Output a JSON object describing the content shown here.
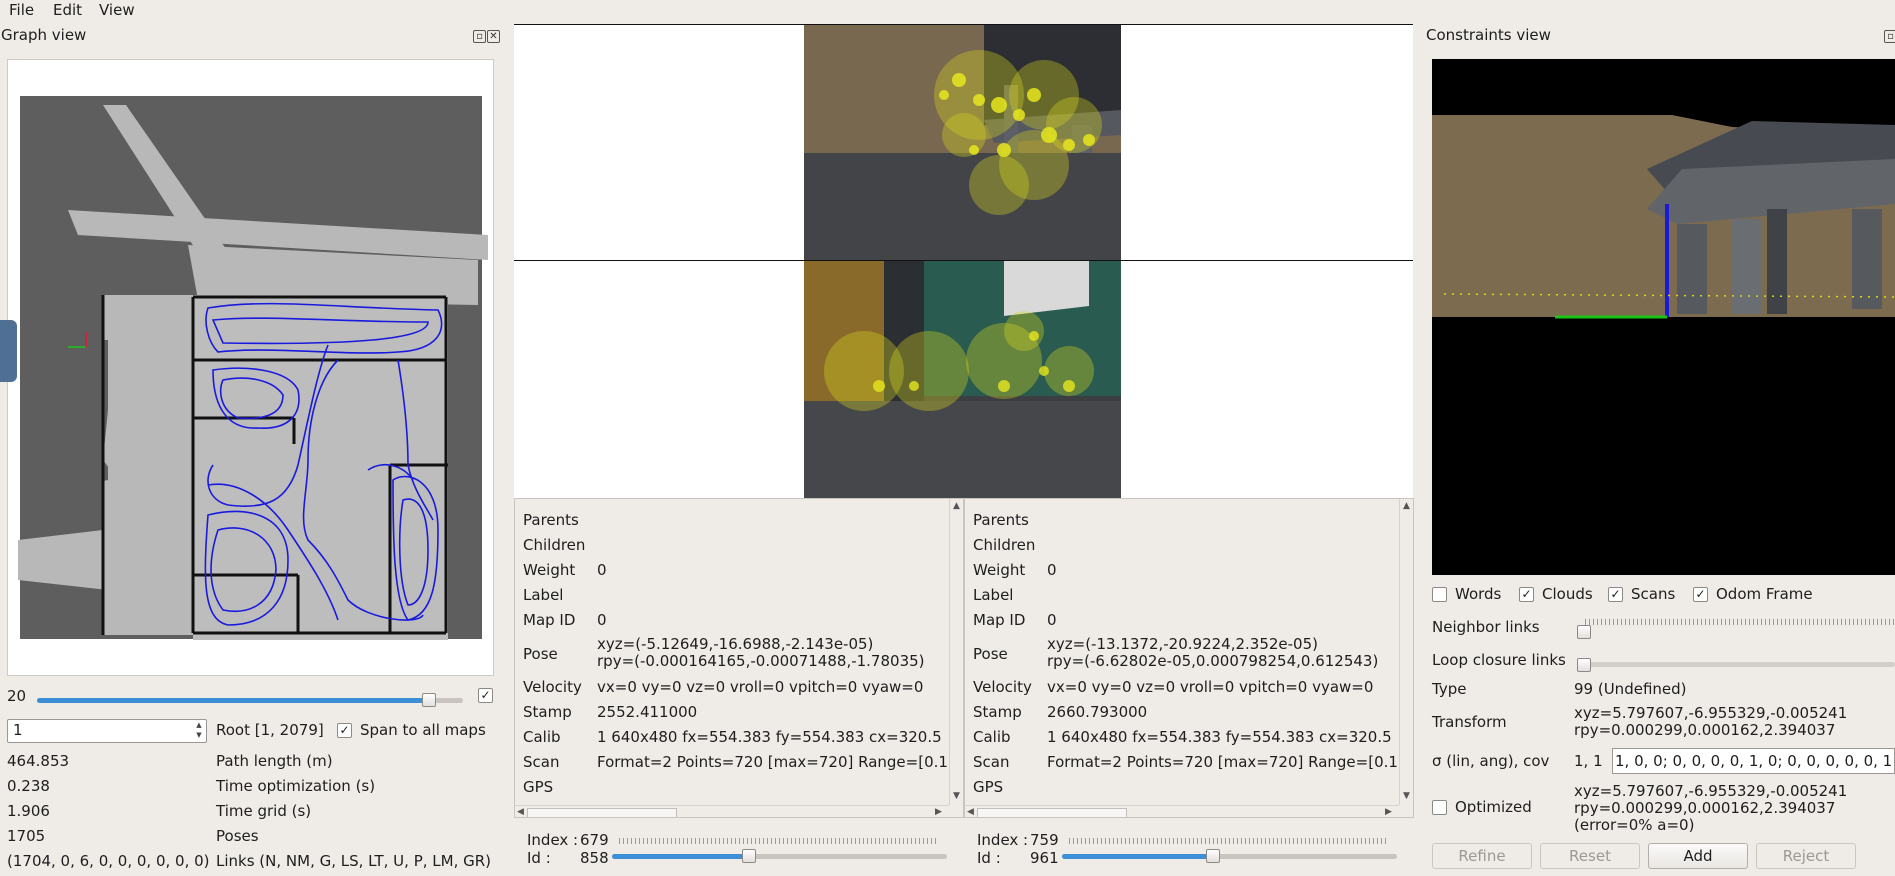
{
  "menu": {
    "file": "File",
    "edit": "Edit",
    "view": "View"
  },
  "graph_view": {
    "title": "Graph view",
    "slider_value": "20",
    "slider_fraction": 0.92,
    "slider_checked": true,
    "spin_value": "1",
    "root_label": "Root [1, 2079]",
    "span_label": "Span to all maps",
    "span_checked": true,
    "stats": [
      {
        "value": "464.853",
        "label": "Path length (m)"
      },
      {
        "value": "0.238",
        "label": "Time optimization (s)"
      },
      {
        "value": "1.906",
        "label": "Time grid (s)"
      },
      {
        "value": "1705",
        "label": "Poses"
      },
      {
        "value": "(1704, 0, 6, 0, 0, 0, 0, 0, 0)",
        "label": "Links (N, NM, G, LS, LT, U, P, LM, GR)"
      }
    ]
  },
  "info_left": {
    "parents": "Parents",
    "children": "Children",
    "weight_label": "Weight",
    "weight": "0",
    "label_label": "Label",
    "mapid_label": "Map ID",
    "mapid": "0",
    "pose_label": "Pose",
    "pose_xyz": "xyz=(-5.12649,-16.6988,-2.143e-05)",
    "pose_rpy": "rpy=(-0.000164165,-0.00071488,-1.78035)",
    "velocity_label": "Velocity",
    "velocity": "vx=0 vy=0 vz=0 vroll=0 vpitch=0 vyaw=0",
    "stamp_label": "Stamp",
    "stamp": "2552.411000",
    "calib_label": "Calib",
    "calib": "1 640x480 fx=554.383 fy=554.383 cx=320.5",
    "scan_label": "Scan",
    "scan": "Format=2 Points=720 [max=720] Range=[0.1",
    "gps_label": "GPS",
    "index_label": "Index :",
    "index": "679",
    "id_label": "Id :",
    "id": "858",
    "id_fraction": 0.41
  },
  "info_right": {
    "parents": "Parents",
    "children": "Children",
    "weight_label": "Weight",
    "weight": "0",
    "label_label": "Label",
    "mapid_label": "Map ID",
    "mapid": "0",
    "pose_label": "Pose",
    "pose_xyz": "xyz=(-13.1372,-20.9224,2.352e-05)",
    "pose_rpy": "rpy=(-6.62802e-05,0.000798254,0.612543)",
    "velocity_label": "Velocity",
    "velocity": "vx=0 vy=0 vz=0 vroll=0 vpitch=0 vyaw=0",
    "stamp_label": "Stamp",
    "stamp": "2660.793000",
    "calib_label": "Calib",
    "calib": "1 640x480 fx=554.383 fy=554.383 cx=320.5",
    "scan_label": "Scan",
    "scan": "Format=2 Points=720 [max=720] Range=[0.1",
    "gps_label": "GPS",
    "index_label": "Index :",
    "index": "759",
    "id_label": "Id :",
    "id": "961",
    "id_fraction": 0.45
  },
  "constraints_view": {
    "title": "Constraints view",
    "words_label": "Words",
    "words_checked": false,
    "clouds_label": "Clouds",
    "clouds_checked": true,
    "scans_label": "Scans",
    "scans_checked": true,
    "odom_label": "Odom Frame",
    "odom_checked": true,
    "neighbor_label": "Neighbor links",
    "loop_label": "Loop closure links",
    "type_label": "Type",
    "type_value": "99  (Undefined)",
    "transform_label": "Transform",
    "transform_xyz": "xyz=5.797607,-6.955329,-0.005241",
    "transform_rpy": "rpy=0.000299,0.000162,2.394037",
    "sigma_label": "σ (lin, ang), cov",
    "sigma_value": "1, 1",
    "cov_value": "1, 0, 0;  0, 0, 0, 0, 1, 0;  0, 0, 0, 0, 0, 1",
    "optimized_label": "Optimized",
    "optimized_checked": false,
    "opt_xyz": "xyz=5.797607,-6.955329,-0.005241",
    "opt_rpy": "rpy=0.000299,0.000162,2.394037",
    "opt_error": "(error=0% a=0)",
    "refine_label": "Refine",
    "reset_label": "Reset",
    "add_label": "Add",
    "reject_label": "Reject"
  },
  "colors": {
    "accent": "#3c8fd6",
    "path": "#1a1adf",
    "feature": "#d8d81e"
  },
  "icons": {
    "check": "check-icon",
    "close": "close-icon",
    "float": "float-icon",
    "arrow": "arrow-icon"
  }
}
